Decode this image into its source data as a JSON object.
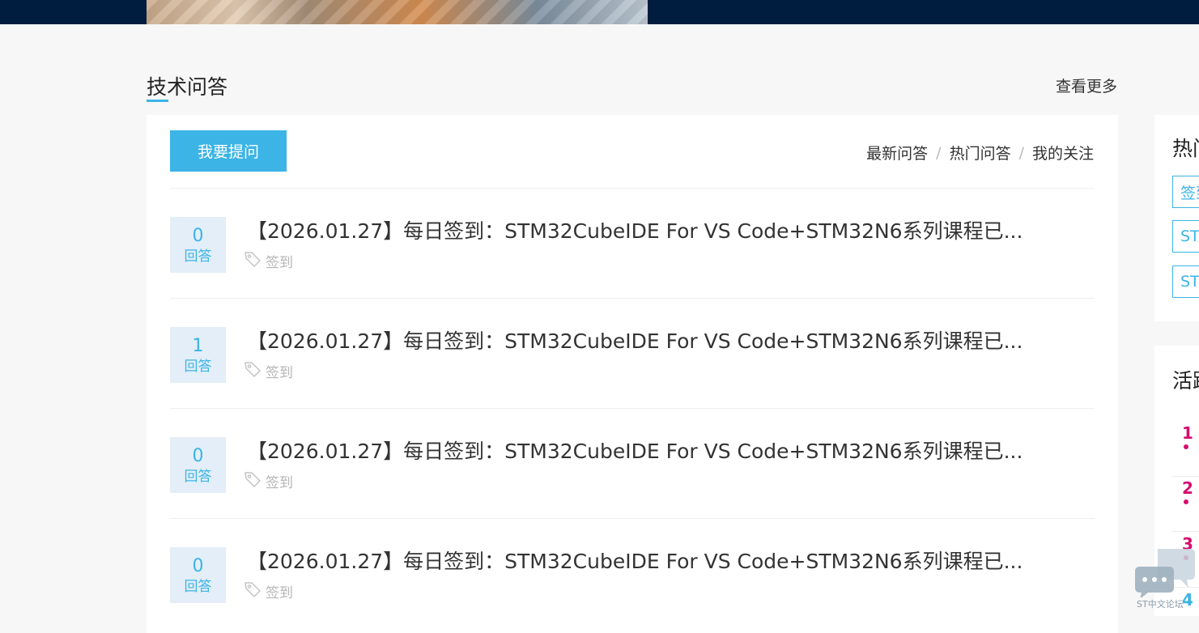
{
  "section": {
    "title": "技术问答",
    "more_label": "查看更多"
  },
  "toolbar": {
    "ask_label": "我要提问",
    "tabs": [
      "最新问答",
      "热门问答",
      "我的关注"
    ],
    "separator": "/"
  },
  "questions": [
    {
      "answers": "0",
      "answers_label": "回答",
      "title": "【2026.01.27】每日签到：STM32CubeIDE For VS Code+STM32N6系列课程已...",
      "tag": "签到"
    },
    {
      "answers": "1",
      "answers_label": "回答",
      "title": "【2026.01.27】每日签到：STM32CubeIDE For VS Code+STM32N6系列课程已...",
      "tag": "签到"
    },
    {
      "answers": "0",
      "answers_label": "回答",
      "title": "【2026.01.27】每日签到：STM32CubeIDE For VS Code+STM32N6系列课程已...",
      "tag": "签到"
    },
    {
      "answers": "0",
      "answers_label": "回答",
      "title": "【2026.01.27】每日签到：STM32CubeIDE For VS Code+STM32N6系列课程已...",
      "tag": "签到"
    }
  ],
  "sidebar": {
    "hot": {
      "title": "热门",
      "tags": [
        "签到",
        "ST",
        "ST"
      ]
    },
    "active": {
      "title": "活跃",
      "ranks": [
        "1",
        "2",
        "3",
        "4"
      ]
    }
  },
  "chat_widget": {
    "label": "ST中文论坛"
  },
  "colors": {
    "accent": "#3cb4e5",
    "rank": "#d60b6f",
    "banner": "#001c3e"
  }
}
